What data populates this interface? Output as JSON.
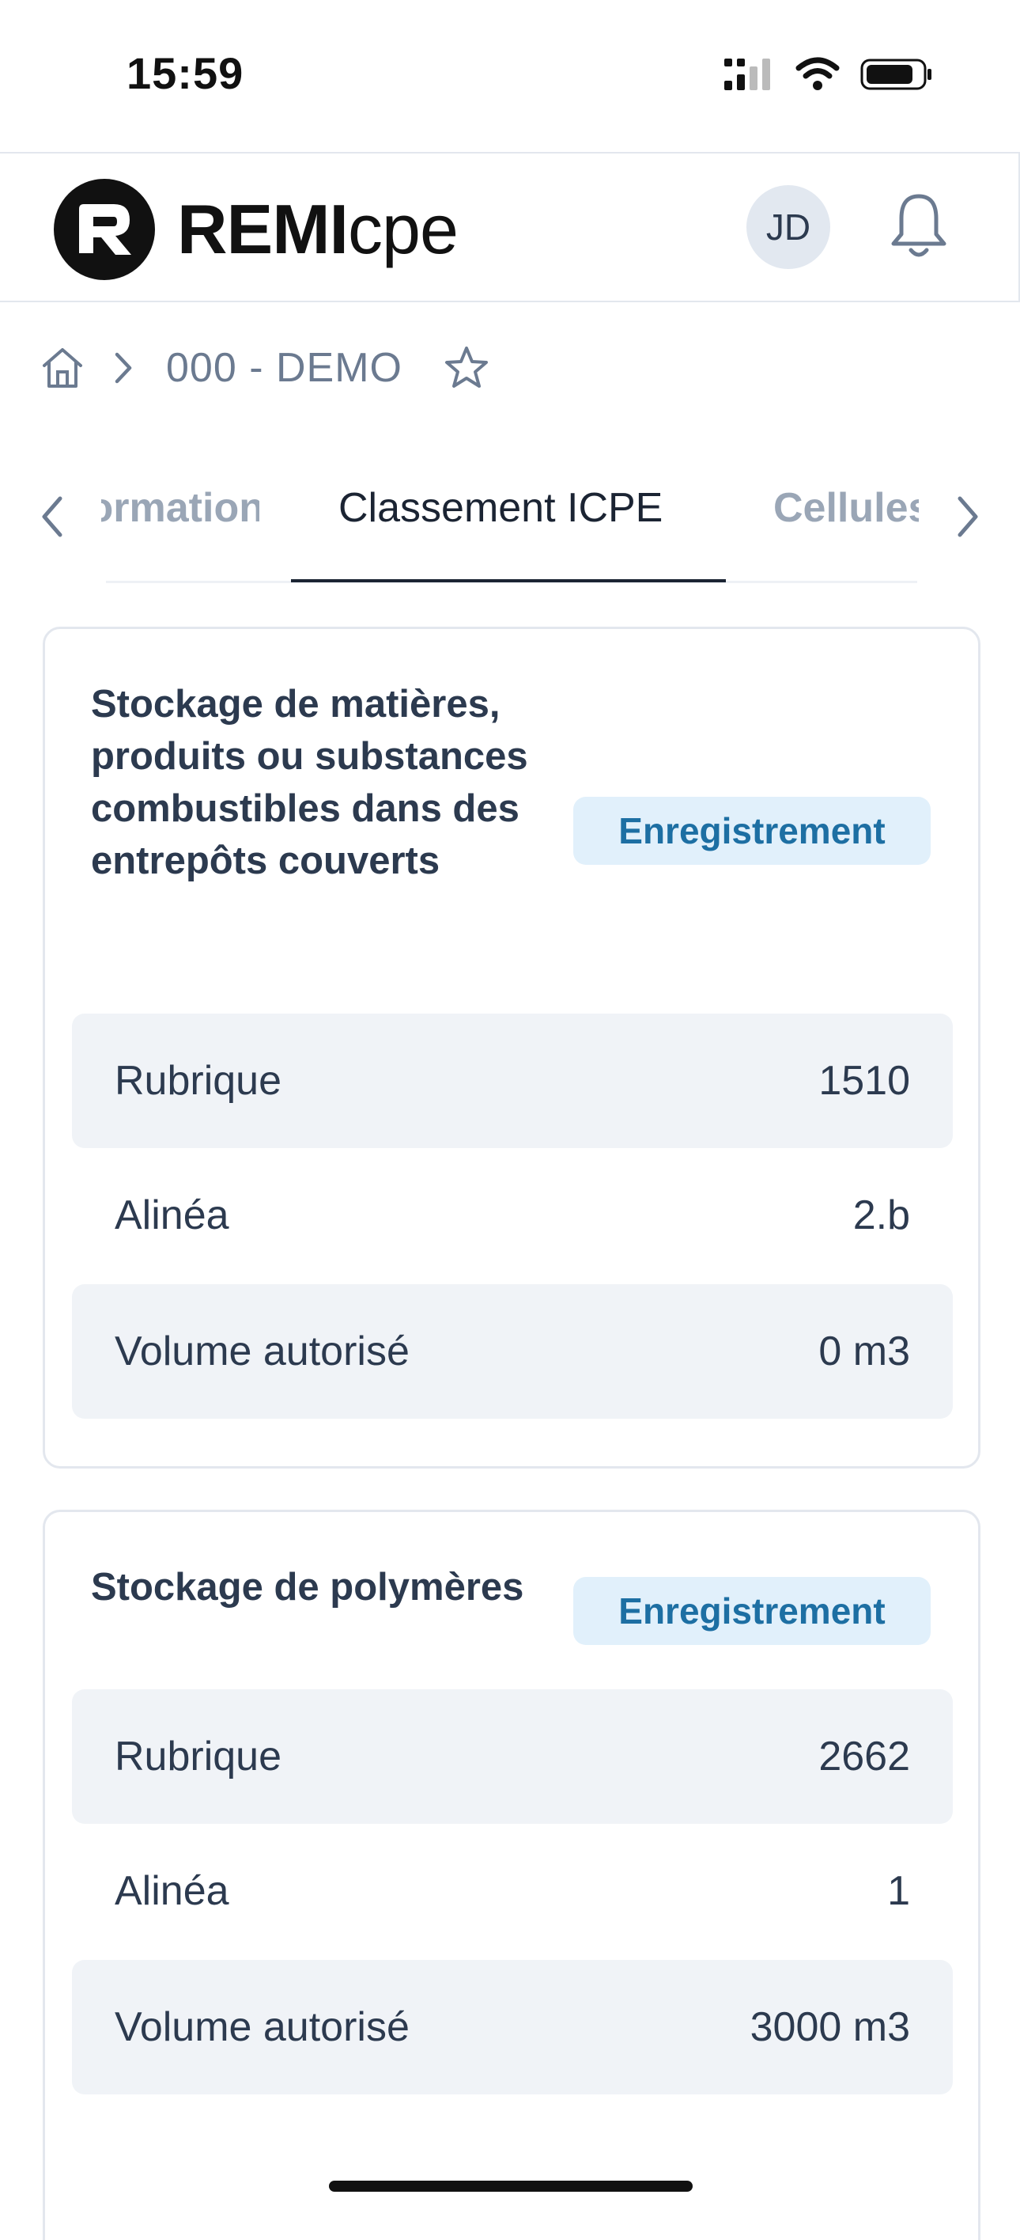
{
  "status_bar": {
    "time": "15:59"
  },
  "header": {
    "logo_bold": "REMI",
    "logo_light": "cpe",
    "avatar_initials": "JD"
  },
  "breadcrumb": {
    "current": "000 - DEMO"
  },
  "tabs": {
    "previous": "Informations",
    "active": "Classement ICPE",
    "next": "Cellules"
  },
  "cards": [
    {
      "title": "Stockage de matières, produits ou substances combustibles dans des entrepôts couverts",
      "badge": "Enregistrement",
      "rows": [
        {
          "label": "Rubrique",
          "value": "1510"
        },
        {
          "label": "Alinéa",
          "value": "2.b"
        },
        {
          "label": "Volume autorisé",
          "value": "0 m3"
        }
      ]
    },
    {
      "title": "Stockage de polymères",
      "badge": "Enregistrement",
      "rows": [
        {
          "label": "Rubrique",
          "value": "2662"
        },
        {
          "label": "Alinéa",
          "value": "1"
        },
        {
          "label": "Volume autorisé",
          "value": "3000 m3"
        }
      ]
    }
  ],
  "colors": {
    "badge_bg": "#e1f0fb",
    "badge_text": "#1d6fa3",
    "row_shade": "#f0f3f7",
    "text_primary": "#2c3a4f"
  }
}
